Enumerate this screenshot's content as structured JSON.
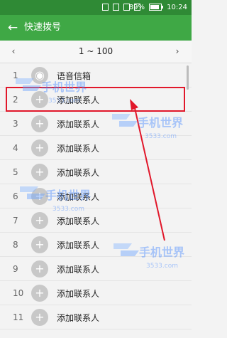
{
  "status_bar": {
    "battery_percent": "89%",
    "time": "10:24"
  },
  "app_bar": {
    "back_icon": "arrow-left-icon",
    "title": "快速拨号"
  },
  "pager": {
    "prev_icon": "chevron-left-icon",
    "next_icon": "chevron-right-icon",
    "range": "1 ~ 100"
  },
  "list": {
    "items": [
      {
        "number": "1",
        "label": "语音信箱",
        "icon": "voicemail-icon"
      },
      {
        "number": "2",
        "label": "添加联系人",
        "icon": "plus-icon"
      },
      {
        "number": "3",
        "label": "添加联系人",
        "icon": "plus-icon"
      },
      {
        "number": "4",
        "label": "添加联系人",
        "icon": "plus-icon"
      },
      {
        "number": "5",
        "label": "添加联系人",
        "icon": "plus-icon"
      },
      {
        "number": "6",
        "label": "添加联系人",
        "icon": "plus-icon"
      },
      {
        "number": "7",
        "label": "添加联系人",
        "icon": "plus-icon"
      },
      {
        "number": "8",
        "label": "添加联系人",
        "icon": "plus-icon"
      },
      {
        "number": "9",
        "label": "添加联系人",
        "icon": "plus-icon"
      },
      {
        "number": "10",
        "label": "添加联系人",
        "icon": "plus-icon"
      },
      {
        "number": "11",
        "label": "添加联系人",
        "icon": "plus-icon"
      }
    ]
  },
  "colors": {
    "status_bar": "#2f8a35",
    "app_bar": "#3fa845",
    "highlight": "#e1172a",
    "annotation_arrow": "#e1172a"
  },
  "watermark": {
    "brand": "手机世界",
    "site": "3533.com"
  }
}
